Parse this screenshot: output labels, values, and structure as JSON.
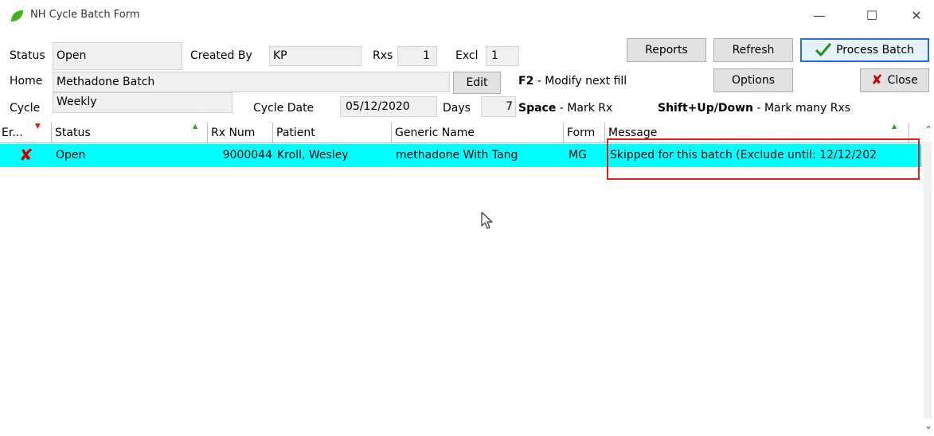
{
  "window": {
    "title": "NH Cycle Batch Form",
    "min": "—",
    "max": "☐",
    "close": "✕"
  },
  "header": {
    "status_label": "Status",
    "status_value": "Open",
    "created_by_label": "Created By",
    "created_by_value": "KP",
    "rxs_label": "Rxs",
    "rxs_value": "1",
    "excl_label": "Excl",
    "excl_value": "1",
    "home_label": "Home",
    "home_value": "Methadone Batch",
    "cycle_label": "Cycle",
    "cycle_value": "Weekly",
    "cycle_date_label": "Cycle Date",
    "cycle_date_value": "05/12/2020",
    "days_label": "Days",
    "days_value": "7",
    "edit_label": "Edit"
  },
  "buttons": {
    "reports": "Reports",
    "refresh": "Refresh",
    "process_batch": "Process Batch",
    "options": "Options",
    "close": "Close"
  },
  "hints": {
    "f2_key": "F2",
    "f2_text": " - Modify next fill",
    "space_key": "Space",
    "space_text": " - Mark Rx",
    "shift_key": "Shift+Up/Down",
    "shift_text": " - Mark many Rxs"
  },
  "grid": {
    "columns": [
      "Er...",
      "Status",
      "Rx Num",
      "Patient",
      "Generic Name",
      "Form",
      "Message"
    ],
    "rows": [
      {
        "error": "✘",
        "status": "Open",
        "rx_num": "9000044",
        "patient": "Kroll, Wesley",
        "generic_name": "methadone With Tang",
        "form": "MG",
        "message": "Skipped for this batch (Exclude until: 12/12/202"
      }
    ]
  },
  "colors": {
    "row_highlight": "#00ffff",
    "error_mark": "#cc0000",
    "annotation_box": "#e02020",
    "primary_border": "#2a6fd0"
  }
}
